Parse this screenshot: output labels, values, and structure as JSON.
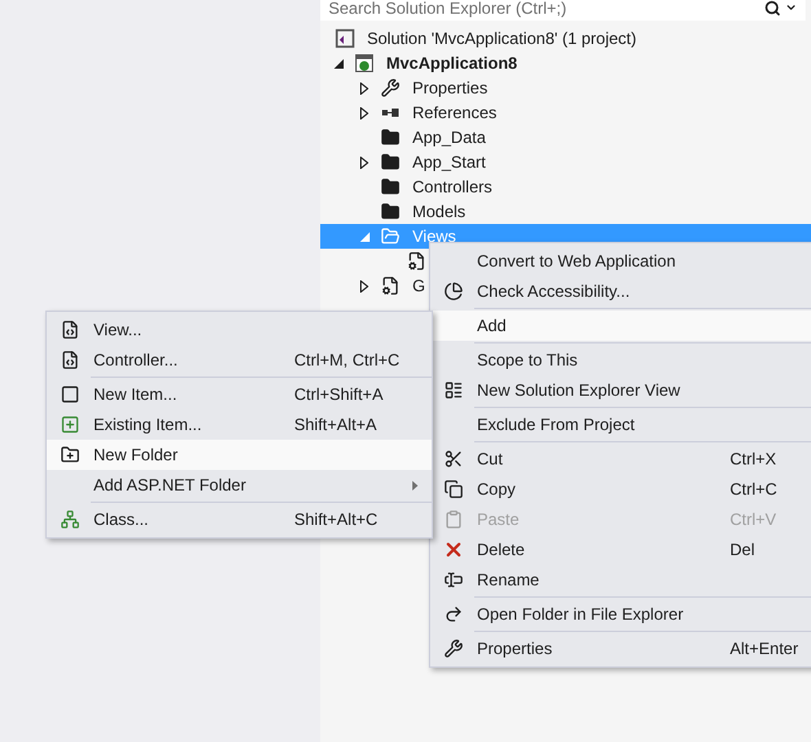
{
  "search": {
    "placeholder": "Search Solution Explorer (Ctrl+;)"
  },
  "tree": [
    {
      "label": "Solution 'MvcApplication8' (1 project)",
      "kind": "solution",
      "selected": false,
      "children": [
        {
          "label": "MvcApplication8",
          "kind": "web-project",
          "bold": true,
          "expanded": true,
          "selected": false,
          "children": [
            {
              "label": "Properties",
              "kind": "wrench",
              "expanded": false,
              "selected": false
            },
            {
              "label": "References",
              "kind": "references",
              "expanded": false,
              "selected": false
            },
            {
              "label": "App_Data",
              "kind": "folder",
              "selected": false
            },
            {
              "label": "App_Start",
              "kind": "folder",
              "expanded": false,
              "selected": false
            },
            {
              "label": "Controllers",
              "kind": "folder",
              "selected": false
            },
            {
              "label": "Models",
              "kind": "folder",
              "selected": false
            },
            {
              "label": "Views",
              "kind": "folder-open",
              "expanded": true,
              "selected": true,
              "children": [
                {
                  "kind": "config-file",
                  "selected": false
                }
              ]
            },
            {
              "label": "G",
              "kind": "gear-file",
              "expanded": false,
              "selected": false
            }
          ]
        }
      ]
    }
  ],
  "context_menu": [
    {
      "kind": "item",
      "label": "Convert to Web Application",
      "selected": false,
      "disabled": false
    },
    {
      "kind": "accessibility",
      "label": "Check Accessibility...",
      "selected": false,
      "disabled": false
    },
    {
      "kind": "separator"
    },
    {
      "kind": "item",
      "label": "Add",
      "selected": true,
      "disabled": false
    },
    {
      "kind": "separator"
    },
    {
      "kind": "item",
      "label": "Scope to This",
      "selected": false,
      "disabled": false
    },
    {
      "kind": "new-view",
      "label": "New Solution Explorer View",
      "selected": false,
      "disabled": false
    },
    {
      "kind": "separator"
    },
    {
      "kind": "item",
      "label": "Exclude From Project",
      "selected": false,
      "disabled": false
    },
    {
      "kind": "separator"
    },
    {
      "kind": "cut",
      "label": "Cut",
      "shortcut": "Ctrl+X",
      "selected": false,
      "disabled": false
    },
    {
      "kind": "copy",
      "label": "Copy",
      "shortcut": "Ctrl+C",
      "selected": false,
      "disabled": false
    },
    {
      "kind": "paste",
      "label": "Paste",
      "shortcut": "Ctrl+V",
      "selected": false,
      "disabled": true
    },
    {
      "kind": "delete",
      "label": "Delete",
      "shortcut": "Del",
      "selected": false,
      "disabled": false
    },
    {
      "kind": "rename",
      "label": "Rename",
      "selected": false,
      "disabled": false
    },
    {
      "kind": "separator"
    },
    {
      "kind": "open-folder",
      "label": "Open Folder in File Explorer",
      "selected": false,
      "disabled": false
    },
    {
      "kind": "separator"
    },
    {
      "kind": "wrench",
      "label": "Properties",
      "shortcut": "Alt+Enter",
      "selected": false,
      "disabled": false
    }
  ],
  "add_submenu": [
    {
      "kind": "page",
      "label": "View...",
      "selected": false
    },
    {
      "kind": "page",
      "label": "Controller...",
      "shortcut": "Ctrl+M, Ctrl+C",
      "selected": false
    },
    {
      "kind": "separator"
    },
    {
      "kind": "new-item",
      "label": "New Item...",
      "shortcut": "Ctrl+Shift+A",
      "selected": false
    },
    {
      "kind": "existing-item",
      "label": "Existing Item...",
      "shortcut": "Shift+Alt+A",
      "selected": false
    },
    {
      "kind": "new-folder",
      "label": "New Folder",
      "selected": true
    },
    {
      "kind": "item",
      "label": "Add ASP.NET Folder",
      "has_submenu": true,
      "selected": false
    },
    {
      "kind": "separator"
    },
    {
      "kind": "class",
      "label": "Class...",
      "shortcut": "Shift+Alt+C",
      "selected": false
    }
  ]
}
